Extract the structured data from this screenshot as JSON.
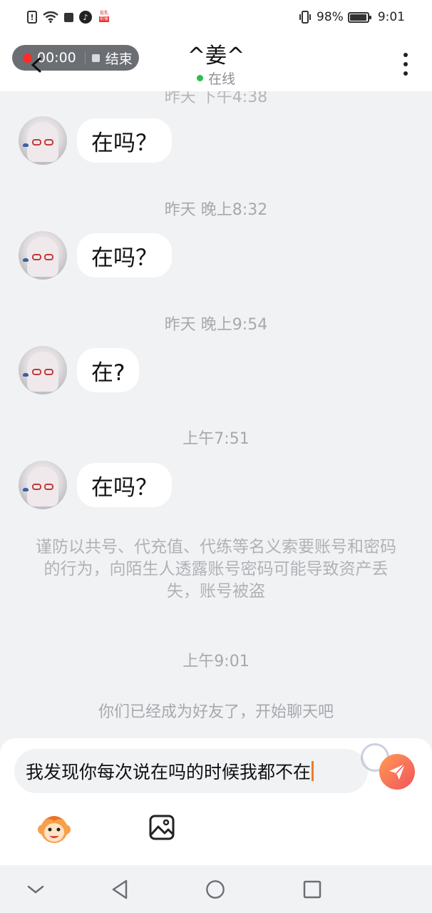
{
  "status_bar": {
    "battery": "98%",
    "battery_level": 0.98,
    "time": "9:01"
  },
  "recording": {
    "time": "00:00",
    "stop_label": "结束"
  },
  "header": {
    "title": "^姜^",
    "status": "在线",
    "status_color": "#2dbd4e"
  },
  "chat": {
    "partial_timestamp": "昨天 下午4:38",
    "messages": [
      {
        "text": "在吗？"
      },
      {
        "timestamp": "昨天 晚上8:32",
        "text": "在吗？"
      },
      {
        "timestamp": "昨天 晚上9:54",
        "text": "在?"
      },
      {
        "timestamp": "上午7:51",
        "text": "在吗？"
      }
    ],
    "security_notice": "谨防以共号、代充值、代练等名义索要账号和密码的行为，向陌生人透露账号密码可能导致资产丢失，账号被盗",
    "friend_timestamp": "上午9:01",
    "friend_note": "你们已经成为好友了，开始聊天吧"
  },
  "composer": {
    "input_value": "我发现你每次说在吗的时候我都不在"
  },
  "colors": {
    "send_gradient_start": "#ff9a55",
    "send_gradient_end": "#f2545b",
    "recording_dot": "#ff2a2a"
  },
  "icons": {
    "back": "back-chevron-icon",
    "more": "more-vertical-icon",
    "send": "paper-plane-icon",
    "emoji": "monkey-emoji-icon",
    "image": "image-icon",
    "nav": [
      "collapse-down-icon",
      "back-triangle-icon",
      "home-circle-icon",
      "recents-square-icon"
    ]
  }
}
